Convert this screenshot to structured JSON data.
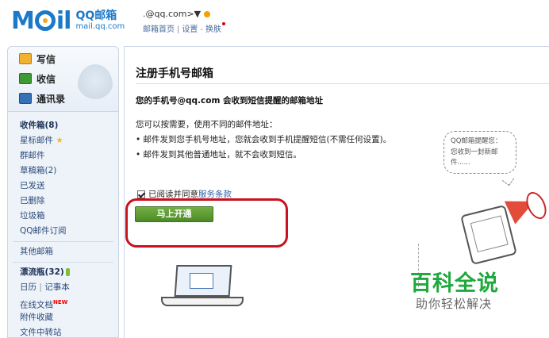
{
  "header": {
    "logo_text": "M",
    "logo_tail": "il",
    "logo_cn": "QQ邮箱",
    "logo_en": "mail.qq.com",
    "account": "        .@qq.com>▼",
    "nav": {
      "home": "邮箱首页",
      "settings": "设置",
      "skin": "换肤"
    }
  },
  "sidebar": {
    "quick": [
      {
        "label": "写信",
        "icon": "compose-icon"
      },
      {
        "label": "收信",
        "icon": "inbox-download-icon"
      },
      {
        "label": "通讯录",
        "icon": "contacts-icon"
      }
    ],
    "folders_1": [
      {
        "label": "收件箱(8)",
        "bold": true
      },
      {
        "label": "星标邮件",
        "star": "★"
      },
      {
        "label": "群邮件"
      },
      {
        "label": "草稿箱(2)"
      },
      {
        "label": "已发送"
      },
      {
        "label": "已删除"
      },
      {
        "label": "垃圾箱"
      },
      {
        "label": "QQ邮件订阅"
      }
    ],
    "folders_2": [
      {
        "label": "其他邮箱"
      }
    ],
    "folders_3": [
      {
        "label": "漂流瓶(32)",
        "bold": true
      },
      {
        "label": "日历",
        "label2": "记事本"
      },
      {
        "label": "在线文档",
        "badge": "NEW"
      },
      {
        "label": "附件收藏"
      },
      {
        "label": "文件中转站"
      }
    ]
  },
  "main": {
    "title": "注册手机号邮箱",
    "subheading": "您的手机号@qq.com 会收到短信提醒的邮箱地址",
    "intro": "您可以按需要，使用不同的邮件地址：",
    "bullets": [
      "• 邮件发到您手机号地址，您就会收到手机提醒短信(不需任何设置)。",
      "• 邮件发到其他普通地址，就不会收到短信。"
    ],
    "agree_text": "已阅读并同意",
    "agree_link": "服务条款",
    "open_button": "马上开通",
    "bubble_line1": "QQ邮箱提醒您：",
    "bubble_line2": "您收到一封新邮件......"
  },
  "watermark": {
    "title": "百科全说",
    "subtitle": "助你轻松解决"
  },
  "colors": {
    "brand_blue": "#1c79c8",
    "button_green": "#5a9b30",
    "highlight_red": "#c8121e",
    "watermark_green": "#1fa83c"
  }
}
